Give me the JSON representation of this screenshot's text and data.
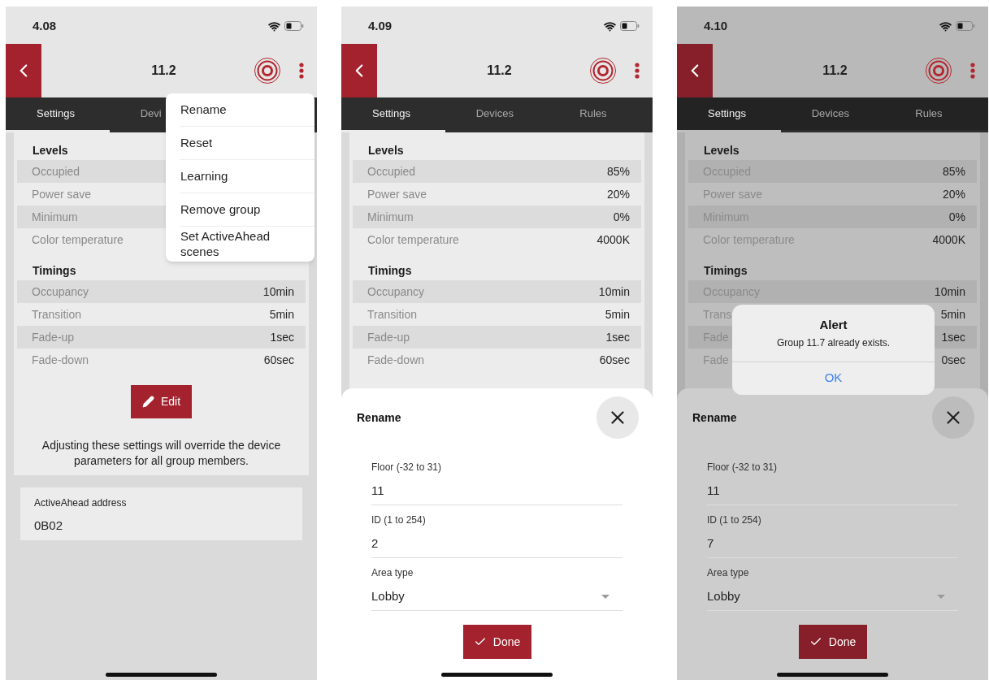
{
  "phones": [
    {
      "status_time": "4.08",
      "title": "11.2",
      "dimmed": false,
      "tabs": [
        {
          "label": "Settings",
          "selected": true
        },
        {
          "label": "Devi",
          "selected": false
        }
      ],
      "sections": [
        {
          "heading": "Levels",
          "rows": [
            {
              "label": "Occupied"
            },
            {
              "label": "Power save"
            },
            {
              "label": "Minimum"
            },
            {
              "label": "Color temperature"
            }
          ]
        },
        {
          "heading": "Timings",
          "rows": [
            {
              "label": "Occupancy",
              "value": "10min"
            },
            {
              "label": "Transition",
              "value": "5min"
            },
            {
              "label": "Fade-up",
              "value": "1sec"
            },
            {
              "label": "Fade-down",
              "value": "60sec"
            }
          ]
        }
      ],
      "edit_button": "Edit",
      "note": "Adjusting these settings will override the device parameters for all group members.",
      "address": {
        "label": "ActiveAhead address",
        "value": "0B02"
      },
      "menu": {
        "items": [
          "Rename",
          "Reset",
          "Learning",
          "Remove group",
          "Set ActiveAhead scenes"
        ]
      }
    },
    {
      "status_time": "4.09",
      "title": "11.2",
      "dimmed": false,
      "tabs": [
        {
          "label": "Settings",
          "selected": true
        },
        {
          "label": "Devices",
          "selected": false
        },
        {
          "label": "Rules",
          "selected": false
        }
      ],
      "sections": [
        {
          "heading": "Levels",
          "rows": [
            {
              "label": "Occupied",
              "value": "85%"
            },
            {
              "label": "Power save",
              "value": "20%"
            },
            {
              "label": "Minimum",
              "value": "0%"
            },
            {
              "label": "Color temperature",
              "value": "4000K"
            }
          ]
        },
        {
          "heading": "Timings",
          "rows": [
            {
              "label": "Occupancy",
              "value": "10min"
            },
            {
              "label": "Transition",
              "value": "5min"
            },
            {
              "label": "Fade-up",
              "value": "1sec"
            },
            {
              "label": "Fade-down",
              "value": "60sec"
            }
          ]
        }
      ],
      "sheet": {
        "title": "Rename",
        "fields": [
          {
            "kind": "text",
            "label": "Floor (-32 to 31)",
            "value": "11"
          },
          {
            "kind": "text",
            "label": "ID (1 to 254)",
            "value": "2"
          },
          {
            "kind": "select",
            "label": "Area type",
            "value": "Lobby"
          }
        ],
        "done": "Done"
      }
    },
    {
      "status_time": "4.10",
      "title": "11.2",
      "dimmed": true,
      "tabs": [
        {
          "label": "Settings",
          "selected": true
        },
        {
          "label": "Devices",
          "selected": false
        },
        {
          "label": "Rules",
          "selected": false
        }
      ],
      "sections": [
        {
          "heading": "Levels",
          "rows": [
            {
              "label": "Occupied",
              "value": "85%"
            },
            {
              "label": "Power save",
              "value": "20%"
            },
            {
              "label": "Minimum",
              "value": "0%"
            },
            {
              "label": "Color temperature",
              "value": "4000K"
            }
          ]
        },
        {
          "heading": "Timings",
          "rows": [
            {
              "label": "Occupancy",
              "value": "10min"
            },
            {
              "label": "Trans",
              "value": "5min"
            },
            {
              "label": "Fade",
              "value": "1sec"
            },
            {
              "label": "Fade",
              "value": "0sec"
            }
          ]
        }
      ],
      "sheet": {
        "title": "Rename",
        "fields": [
          {
            "kind": "text",
            "label": "Floor (-32 to 31)",
            "value": "11"
          },
          {
            "kind": "text",
            "label": "ID (1 to 254)",
            "value": "7"
          },
          {
            "kind": "select",
            "label": "Area type",
            "value": "Lobby"
          }
        ],
        "done": "Done"
      },
      "alert": {
        "title": "Alert",
        "message": "Group 11.7 already exists.",
        "button": "OK"
      }
    }
  ]
}
